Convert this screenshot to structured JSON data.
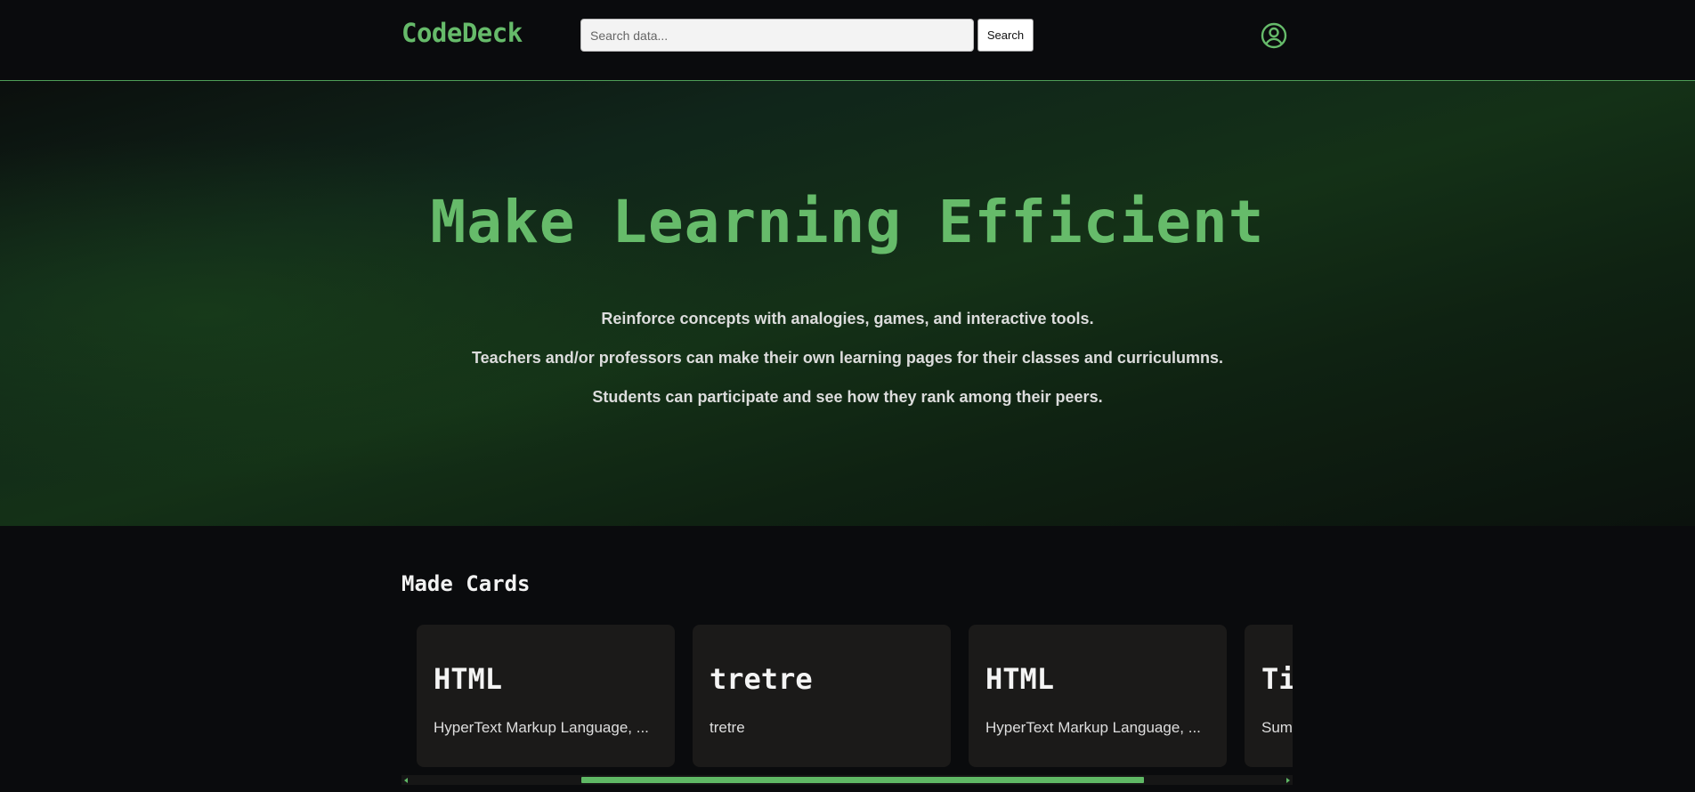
{
  "header": {
    "logo": "CodeDeck",
    "search_placeholder": "Search data...",
    "search_value": "",
    "search_button": "Search",
    "profile_icon": "user-circle-icon"
  },
  "hero": {
    "title": "Make Learning Efficient",
    "lines": [
      "Reinforce concepts with analogies, games, and interactive tools.",
      "Teachers and/or professors can make their own learning pages for their classes and curriculumns.",
      "Students can participate and see how they rank among their peers."
    ]
  },
  "made_cards": {
    "title": "Made Cards",
    "cards": [
      {
        "title": "HTML",
        "description": "HyperText Markup Language, ..."
      },
      {
        "title": "tretre",
        "description": "tretre"
      },
      {
        "title": "HTML",
        "description": "HyperText Markup Language, ..."
      },
      {
        "title": "Ti",
        "description": "Sum"
      }
    ]
  },
  "colors": {
    "accent": "#66bb6a",
    "background": "#0a0b0d",
    "card": "#1b1a19"
  }
}
